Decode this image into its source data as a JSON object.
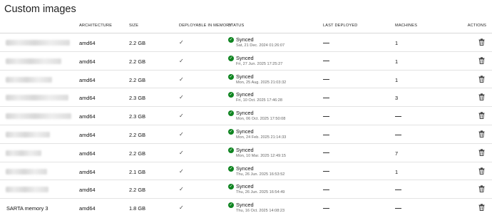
{
  "page": {
    "title": "Custom images"
  },
  "headers": {
    "architecture": "ARCHITECTURE",
    "size": "SIZE",
    "deployable": "DEPLOYABLE IN MEMORY",
    "status": "STATUS",
    "last_deployed": "LAST DEPLOYED",
    "machines": "MACHINES",
    "actions": "ACTIONS"
  },
  "rows": [
    {
      "name": "",
      "arch": "amd64",
      "size": "2.2 GB",
      "deployable": "✓",
      "status": "Synced",
      "status_time": "Sat, 21 Dec. 2024 01:26:07",
      "last_deployed": "",
      "machines": "1"
    },
    {
      "name": "",
      "arch": "amd64",
      "size": "2.2 GB",
      "deployable": "✓",
      "status": "Synced",
      "status_time": "Fri, 27 Jun. 2025 17:25:27",
      "last_deployed": "",
      "machines": "1"
    },
    {
      "name": "",
      "arch": "amd64",
      "size": "2.2 GB",
      "deployable": "✓",
      "status": "Synced",
      "status_time": "Mon, 25 Aug. 2025 21:03:32",
      "last_deployed": "",
      "machines": "1"
    },
    {
      "name": "",
      "arch": "amd64",
      "size": "2.3 GB",
      "deployable": "✓",
      "status": "Synced",
      "status_time": "Fri, 10 Oct. 2025 17:46:28",
      "last_deployed": "",
      "machines": "3"
    },
    {
      "name": "",
      "arch": "amd64",
      "size": "2.3 GB",
      "deployable": "✓",
      "status": "Synced",
      "status_time": "Mon, 06 Oct. 2025 17:50:08",
      "last_deployed": "",
      "machines": ""
    },
    {
      "name": "",
      "arch": "amd64",
      "size": "2.2 GB",
      "deployable": "✓",
      "status": "Synced",
      "status_time": "Mon, 24 Feb. 2025 21:14:33",
      "last_deployed": "",
      "machines": ""
    },
    {
      "name": "",
      "arch": "amd64",
      "size": "2.2 GB",
      "deployable": "✓",
      "status": "Synced",
      "status_time": "Mon, 10 Mar. 2025 12:49:15",
      "last_deployed": "",
      "machines": "7"
    },
    {
      "name": "",
      "arch": "amd64",
      "size": "2.1 GB",
      "deployable": "✓",
      "status": "Synced",
      "status_time": "Thu, 26 Jun. 2025 16:53:52",
      "last_deployed": "",
      "machines": "1"
    },
    {
      "name": "",
      "arch": "amd64",
      "size": "2.2 GB",
      "deployable": "✓",
      "status": "Synced",
      "status_time": "Thu, 26 Jun. 2025 16:54:49",
      "last_deployed": "",
      "machines": ""
    },
    {
      "name": "SARTA memory 3",
      "arch": "amd64",
      "size": "1.8 GB",
      "deployable": "✓",
      "status": "Synced",
      "status_time": "Thu, 16 Oct. 2025 14:08:23",
      "last_deployed": "",
      "machines": ""
    }
  ],
  "icons": {
    "status": "check-circle-icon",
    "action": "trash-icon",
    "empty_value": "dash-icon"
  },
  "colors": {
    "synced": "#0e8420"
  }
}
